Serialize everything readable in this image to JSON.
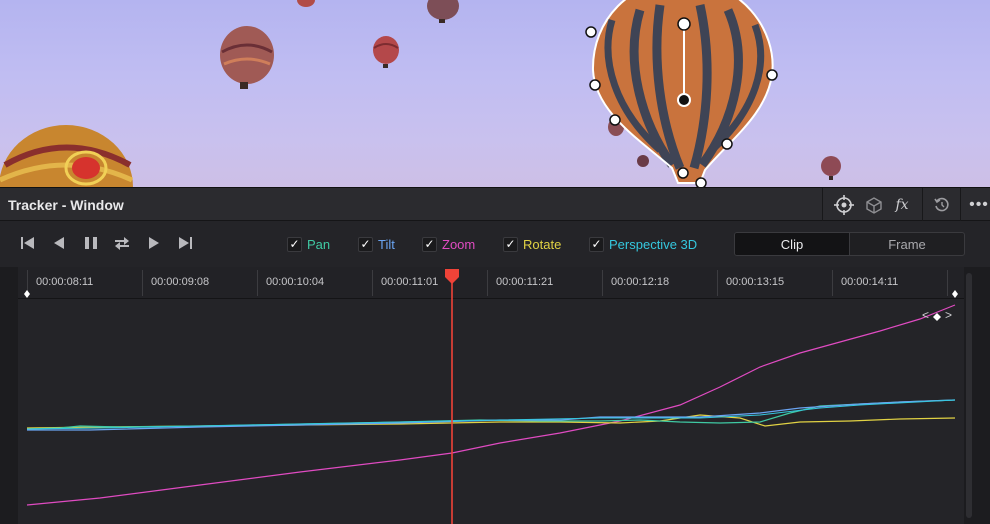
{
  "panel": {
    "title": "Tracker - Window"
  },
  "header_icons": [
    {
      "name": "crosshair-icon"
    },
    {
      "name": "cloud-tracker-icon"
    },
    {
      "name": "fx-icon"
    },
    {
      "name": "reset-icon"
    },
    {
      "name": "more-options-icon"
    }
  ],
  "transport": [
    {
      "name": "track-backward-icon"
    },
    {
      "name": "track-one-frame-reverse-icon"
    },
    {
      "name": "stop-tracking-icon"
    },
    {
      "name": "track-forward-and-reverse-icon"
    },
    {
      "name": "track-one-frame-forward-icon"
    },
    {
      "name": "track-forward-icon"
    }
  ],
  "checkboxes": [
    {
      "label": "Pan",
      "checked": true,
      "color": "#3fc9a3"
    },
    {
      "label": "Tilt",
      "checked": true,
      "color": "#6aa4f2"
    },
    {
      "label": "Zoom",
      "checked": true,
      "color": "#e04bc2"
    },
    {
      "label": "Rotate",
      "checked": true,
      "color": "#e1d244"
    },
    {
      "label": "Perspective 3D",
      "checked": true,
      "color": "#35c7de"
    }
  ],
  "mode_toggle": {
    "selected": "Clip",
    "options": [
      "Clip",
      "Frame"
    ]
  },
  "timeline": {
    "timecodes": [
      "00:00:08:11",
      "00:00:09:08",
      "00:00:10:04",
      "00:00:11:01",
      "00:00:11:21",
      "00:00:12:18",
      "00:00:13:15",
      "00:00:14:11"
    ],
    "playhead_color": "#ef4338"
  },
  "colors": {
    "pan": "#3fc9a3",
    "tilt": "#6aa4f2",
    "zoom": "#e04bc2",
    "rotate": "#e1d244",
    "perspective": "#35c7de",
    "playhead": "#ef4338"
  }
}
